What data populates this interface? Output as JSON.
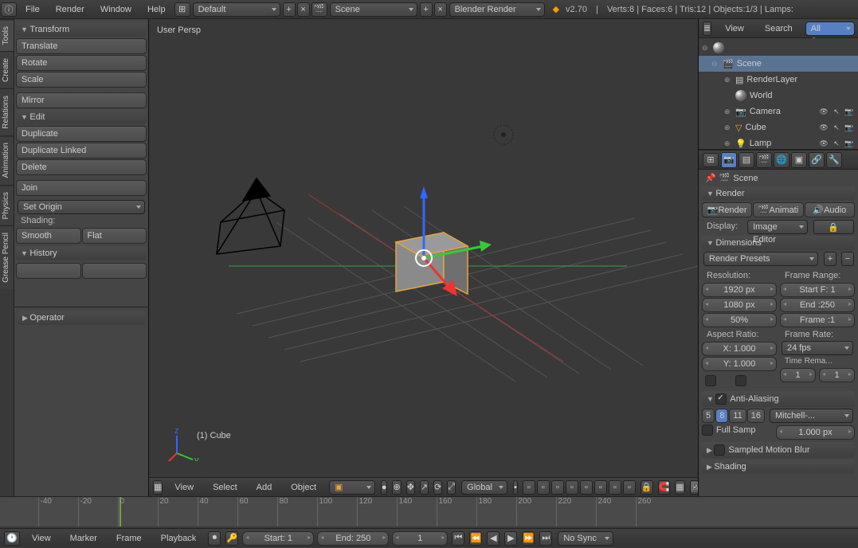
{
  "top": {
    "menus": [
      "File",
      "Render",
      "Window",
      "Help"
    ],
    "layout": "Default",
    "scene": "Scene",
    "engine": "Blender Render",
    "version": "v2.70",
    "stats": "Verts:8 | Faces:6 | Tris:12 | Objects:1/3 | Lamps:"
  },
  "vtabs": [
    "Tools",
    "Create",
    "Relations",
    "Animation",
    "Physics",
    "Grease Pencil"
  ],
  "tool": {
    "transform_hdr": "Transform",
    "translate": "Translate",
    "rotate": "Rotate",
    "scale": "Scale",
    "mirror": "Mirror",
    "edit_hdr": "Edit",
    "duplicate": "Duplicate",
    "duplicate_linked": "Duplicate Linked",
    "delete": "Delete",
    "join": "Join",
    "set_origin": "Set Origin",
    "shading_label": "Shading:",
    "smooth": "Smooth",
    "flat": "Flat",
    "history_hdr": "History",
    "operator_hdr": "Operator"
  },
  "viewport": {
    "persp": "User Persp",
    "object": "(1) Cube",
    "hdr_menus": [
      "View",
      "Select",
      "Add",
      "Object"
    ],
    "mode": "Object Mode",
    "orientation": "Global"
  },
  "outliner": {
    "hdr": [
      "View",
      "Search"
    ],
    "all_scenes": "All Scenes",
    "scene": "Scene",
    "render_layers": "RenderLayer",
    "world": "World",
    "camera": "Camera",
    "cube": "Cube",
    "lamp": "Lamp"
  },
  "props": {
    "breadcrumb": "Scene",
    "render_hdr": "Render",
    "render_btn": "Render",
    "anim_btn": "Animati",
    "audio_btn": "Audio",
    "display_label": "Display:",
    "display_value": "Image Editor",
    "dimensions_hdr": "Dimensions",
    "render_presets": "Render Presets",
    "resolution_label": "Resolution:",
    "res_x": "1920 px",
    "res_y": "1080 px",
    "res_pct": "50%",
    "frame_range_label": "Frame Range:",
    "start_f": "Start F: 1",
    "end_f": "End :250",
    "frame_step": "Frame :1",
    "aspect_label": "Aspect Ratio:",
    "aspect_x": "X: 1.000",
    "aspect_y": "Y: 1.000",
    "frame_rate_label": "Frame Rate:",
    "fps": "24 fps",
    "time_remap": "Time Rema...",
    "tr_old": "1",
    "tr_new": "1",
    "aa_hdr": "Anti-Aliasing",
    "aa_samples": [
      "5",
      "8",
      "11",
      "16"
    ],
    "aa_filter": "Mitchell-...",
    "full_sample": "Full Samp",
    "aa_px": "1.000 px",
    "smb_hdr": "Sampled Motion Blur",
    "shading_hdr": "Shading"
  },
  "timeline": {
    "menus": [
      "View",
      "Marker",
      "Frame",
      "Playback"
    ],
    "start_label": "Start:",
    "start_val": "1",
    "end_label": "End:",
    "end_val": "250",
    "current": "1",
    "sync": "No Sync",
    "ticks": [
      -40,
      -20,
      0,
      20,
      40,
      60,
      80,
      100,
      120,
      140,
      160,
      180,
      200,
      220,
      240,
      260
    ]
  }
}
